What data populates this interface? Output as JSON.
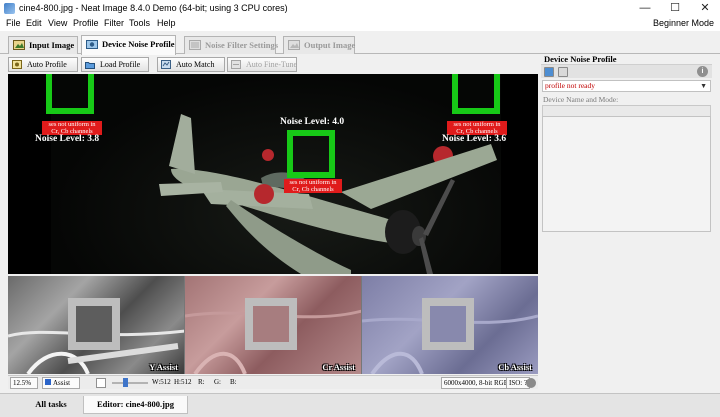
{
  "window": {
    "title": "cine4-800.jpg - Neat Image 8.4.0 Demo (64-bit; using 3 CPU cores)",
    "minimize": "—",
    "maximize": "☐",
    "close": "✕"
  },
  "menu": {
    "items": [
      "File",
      "Edit",
      "View",
      "Profile",
      "Filter",
      "Tools",
      "Help"
    ],
    "mode": "Beginner Mode"
  },
  "tabs": [
    {
      "label": "Input Image",
      "icon": "input-image-icon",
      "state": "normal"
    },
    {
      "label": "Device Noise Profile",
      "icon": "noise-profile-icon",
      "state": "active"
    },
    {
      "label": "Noise Filter Settings",
      "icon": "filter-settings-icon",
      "state": "disabled"
    },
    {
      "label": "Output Image",
      "icon": "output-image-icon",
      "state": "disabled"
    }
  ],
  "toolbar": {
    "auto_profile": "Auto Profile",
    "load_profile": "Load Profile",
    "auto_match": "Auto Match",
    "auto_fine_tune": "Auto Fine-Tune"
  },
  "main_image": {
    "annotations": {
      "left_warning": "ses not uniform in\nCr, Cb channels",
      "left_level": "Noise Level: 3.8",
      "center_level": "Noise Level: 4.0",
      "center_warning": "ses not uniform in\nCr, Cb channels",
      "right_warning": "ses not uniform in\nCr, Cb channels",
      "right_level": "Noise Level: 3.6"
    }
  },
  "thumbnails": [
    {
      "label": "Y Assist"
    },
    {
      "label": "Cr Assist"
    },
    {
      "label": "Cb Assist"
    }
  ],
  "statusbar": {
    "zoom": "12.5%",
    "view_mode": "Assist",
    "width": "W:512",
    "height": "H:512",
    "r": "R:",
    "g": "G:",
    "b": "B:",
    "image_info": "6000x4000, 8-bit RGB",
    "iso": "ISO: ?"
  },
  "right_panel": {
    "title": "Device Noise Profile",
    "profile_status": "profile not ready",
    "device_label": "Device Name and Mode:",
    "info": "i"
  },
  "bottom_tabs": {
    "all_tasks": "All tasks",
    "editor": "Editor: cine4-800.jpg"
  },
  "colors": {
    "marker_green": "#17c917",
    "warning_red": "#e01b1b",
    "status_red": "#c00000"
  }
}
